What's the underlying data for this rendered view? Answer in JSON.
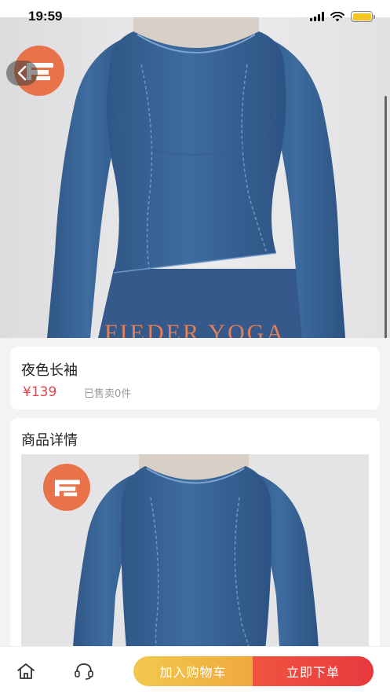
{
  "status_bar": {
    "time": "19:59",
    "icons": [
      "signal-icon",
      "wifi-icon",
      "battery-icon"
    ],
    "battery_color": "#f5c623"
  },
  "hero": {
    "watermark": "FIEDER YOGA",
    "brand_color": "#e8734a",
    "shirt_color": "#3b6699",
    "pager": {
      "count": 2,
      "active": 1
    }
  },
  "product": {
    "name": "夜色长袖",
    "price": "¥139",
    "sold": "已售卖0件",
    "price_color": "#e2454b"
  },
  "detail": {
    "title": "商品详情"
  },
  "bottom_bar": {
    "home_icon": "home-icon",
    "service_icon": "headset-icon",
    "cart_label": "加入购物车",
    "buy_label": "立即下单",
    "cart_color": "#f2c94e",
    "buy_color": "#e8393f"
  }
}
